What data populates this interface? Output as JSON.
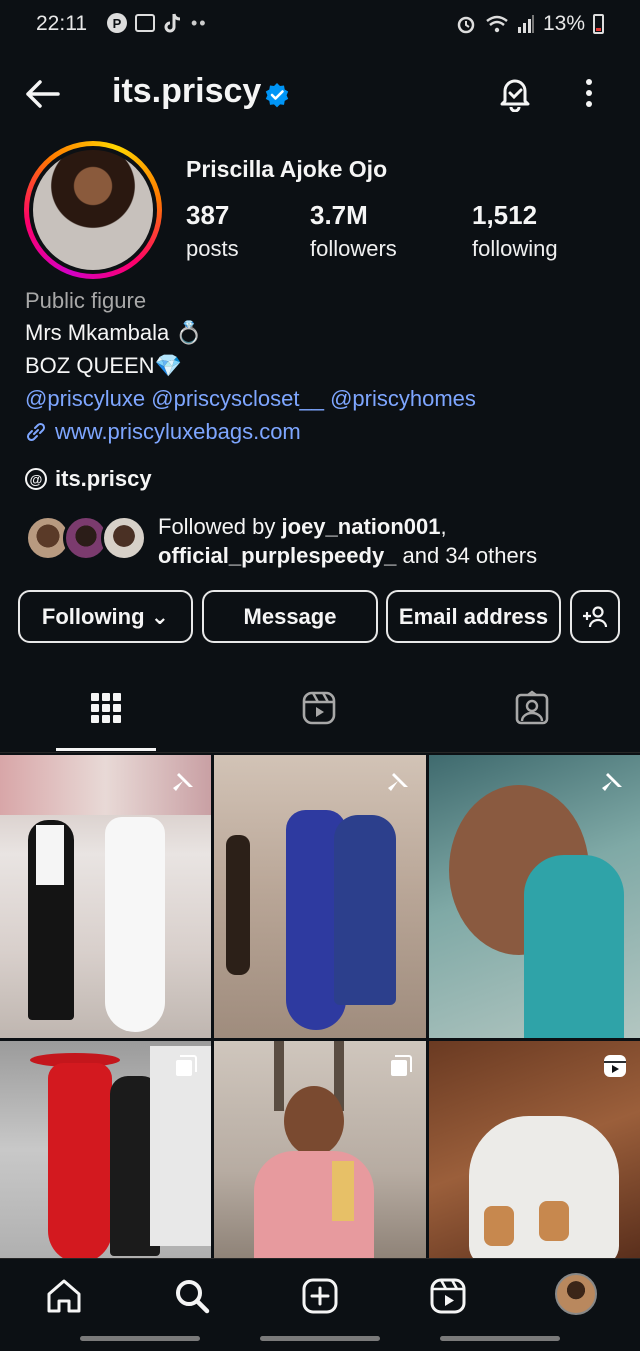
{
  "status_bar": {
    "time": "22:11",
    "battery": "13%"
  },
  "header": {
    "username": "its.priscy"
  },
  "profile": {
    "full_name": "Priscilla Ajoke Ojo",
    "stats": {
      "posts": {
        "value": "387",
        "label": "posts"
      },
      "followers": {
        "value": "3.7M",
        "label": "followers"
      },
      "following": {
        "value": "1,512",
        "label": "following"
      }
    },
    "category": "Public figure",
    "bio_line1": "Mrs Mkambala 💍",
    "bio_line2": "BOZ QUEEN💎",
    "mentions": "@priscyluxe @priscyscloset__ @priscyhomes",
    "website": "www.priscyluxebags.com",
    "threads_handle": "its.priscy",
    "followed_by": {
      "prefix": "Followed by ",
      "user1": "joey_nation001",
      "comma": ",",
      "user2": "official_purplespeedy_",
      "suffix": " and 34 others"
    }
  },
  "actions": {
    "following": "Following ⌄",
    "message": "Message",
    "email": "Email address"
  },
  "colors": {
    "background": "#0c1014",
    "link": "#7ea6ff",
    "verified": "#0095f6"
  },
  "grid": {
    "tiles": [
      {
        "kind": "pinned"
      },
      {
        "kind": "pinned"
      },
      {
        "kind": "pinned"
      },
      {
        "kind": "carousel"
      },
      {
        "kind": "carousel"
      },
      {
        "kind": "reel"
      }
    ]
  }
}
